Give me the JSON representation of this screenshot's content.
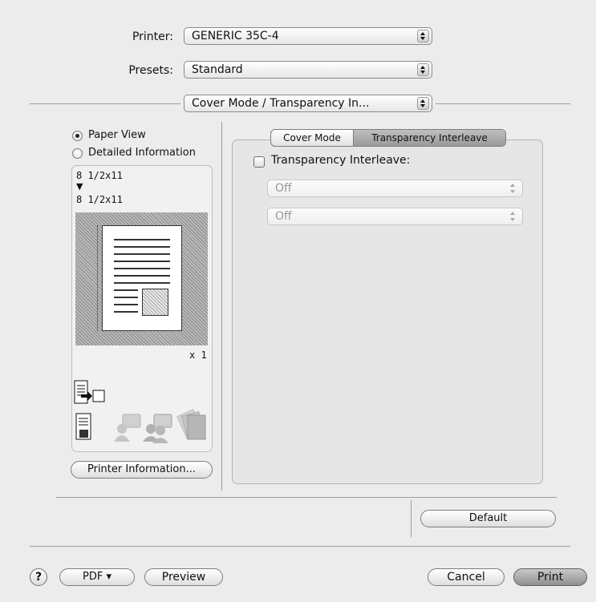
{
  "printer": {
    "label": "Printer:",
    "value": "GENERIC 35C-4"
  },
  "presets": {
    "label": "Presets:",
    "value": "Standard"
  },
  "panel_menu": {
    "value": "Cover Mode / Transparency In..."
  },
  "view_options": [
    {
      "label": "Paper View",
      "selected": true
    },
    {
      "label": "Detailed Information",
      "selected": false
    }
  ],
  "preview": {
    "source_size": "8 1/2x11",
    "arrow": "▼",
    "output_size": "8 1/2x11",
    "copies": "x 1"
  },
  "printer_info_button": "Printer Information...",
  "tabs": [
    {
      "label": "Cover Mode",
      "selected": false
    },
    {
      "label": "Transparency Interleave",
      "selected": true
    }
  ],
  "transparency": {
    "checkbox_label": "Transparency Interleave:",
    "checked": false,
    "select1": "Off",
    "select2": "Off"
  },
  "default_button": "Default",
  "footer": {
    "help": "?",
    "pdf": "PDF ▾",
    "preview": "Preview",
    "cancel": "Cancel",
    "print": "Print"
  },
  "icons": [
    "staple-output-icon",
    "printer-document-icon",
    "user-auth-icon",
    "account-track-icon",
    "tray-stack-icon"
  ]
}
